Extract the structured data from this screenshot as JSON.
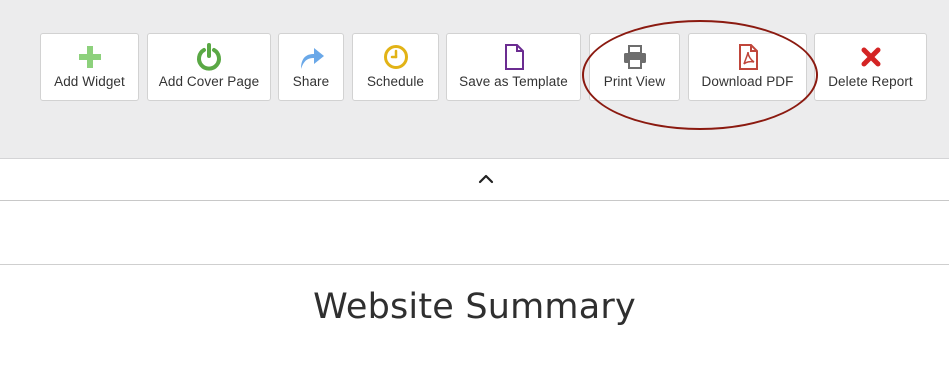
{
  "toolbar": {
    "buttons": [
      {
        "label": "Add Widget",
        "icon": "plus-icon",
        "color": "#8dd17c"
      },
      {
        "label": "Add Cover Page",
        "icon": "power-icon",
        "color": "#5aa845"
      },
      {
        "label": "Share",
        "icon": "share-arrow-icon",
        "color": "#6aa8e8"
      },
      {
        "label": "Schedule",
        "icon": "clock-icon",
        "color": "#e2b316"
      },
      {
        "label": "Save as Template",
        "icon": "document-icon",
        "color": "#6b2c91"
      },
      {
        "label": "Print View",
        "icon": "printer-icon",
        "color": "#6d6d6d"
      },
      {
        "label": "Download PDF",
        "icon": "pdf-icon",
        "color": "#c0463b"
      },
      {
        "label": "Delete Report",
        "icon": "delete-x-icon",
        "color": "#d42424"
      }
    ],
    "highlight_color": "#8b1a10"
  },
  "collapse": {
    "icon": "chevron-up-icon"
  },
  "main": {
    "title": "Website Summary"
  }
}
